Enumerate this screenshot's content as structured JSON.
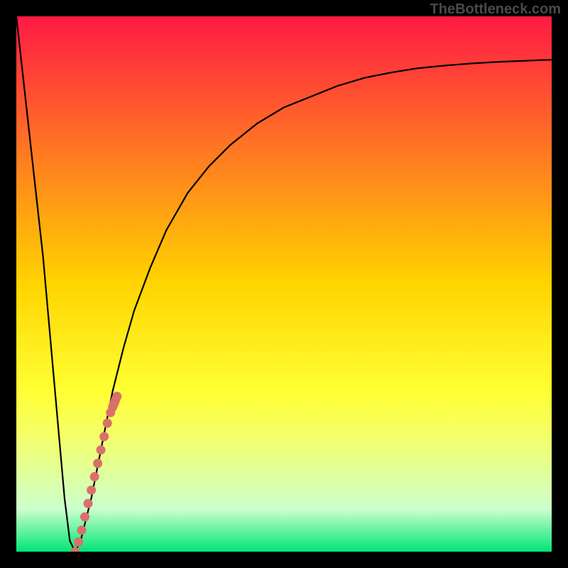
{
  "watermark": "TheBottleneck.com",
  "chart_data": {
    "type": "line",
    "title": "",
    "xlabel": "",
    "ylabel": "",
    "xlim": [
      0,
      100
    ],
    "ylim": [
      0,
      100
    ],
    "gradient_stops": [
      {
        "offset": 0,
        "color": "#ff1a44"
      },
      {
        "offset": 50,
        "color": "#ffd400"
      },
      {
        "offset": 70,
        "color": "#ffff33"
      },
      {
        "offset": 78,
        "color": "#f5ff66"
      },
      {
        "offset": 92,
        "color": "#ccffcc"
      },
      {
        "offset": 100,
        "color": "#00e676"
      }
    ],
    "series": [
      {
        "name": "curve",
        "type": "line",
        "color": "#000000",
        "x": [
          0,
          5,
          9,
          10,
          11,
          12,
          14,
          16,
          18,
          20,
          22,
          25,
          28,
          32,
          36,
          40,
          45,
          50,
          55,
          60,
          65,
          70,
          75,
          80,
          85,
          90,
          95,
          100
        ],
        "y": [
          100,
          55,
          10,
          2,
          0,
          2,
          10,
          20,
          30,
          38,
          45,
          53,
          60,
          67,
          72,
          76,
          80,
          83,
          85,
          87,
          88.5,
          89.5,
          90.3,
          90.8,
          91.2,
          91.5,
          91.7,
          91.9
        ]
      },
      {
        "name": "dots",
        "type": "scatter",
        "color": "#d9706a",
        "x": [
          11.0,
          11.6,
          12.2,
          12.8,
          13.4,
          14.0,
          14.6,
          15.2,
          15.8,
          16.4,
          17.0,
          17.6,
          18.0,
          18.2,
          18.4,
          18.6,
          18.8
        ],
        "y": [
          0,
          1.8,
          4.0,
          6.5,
          9.0,
          11.5,
          14.0,
          16.5,
          19.0,
          21.5,
          24.0,
          26.0,
          27.0,
          27.5,
          28.0,
          28.5,
          29.0
        ]
      }
    ]
  }
}
